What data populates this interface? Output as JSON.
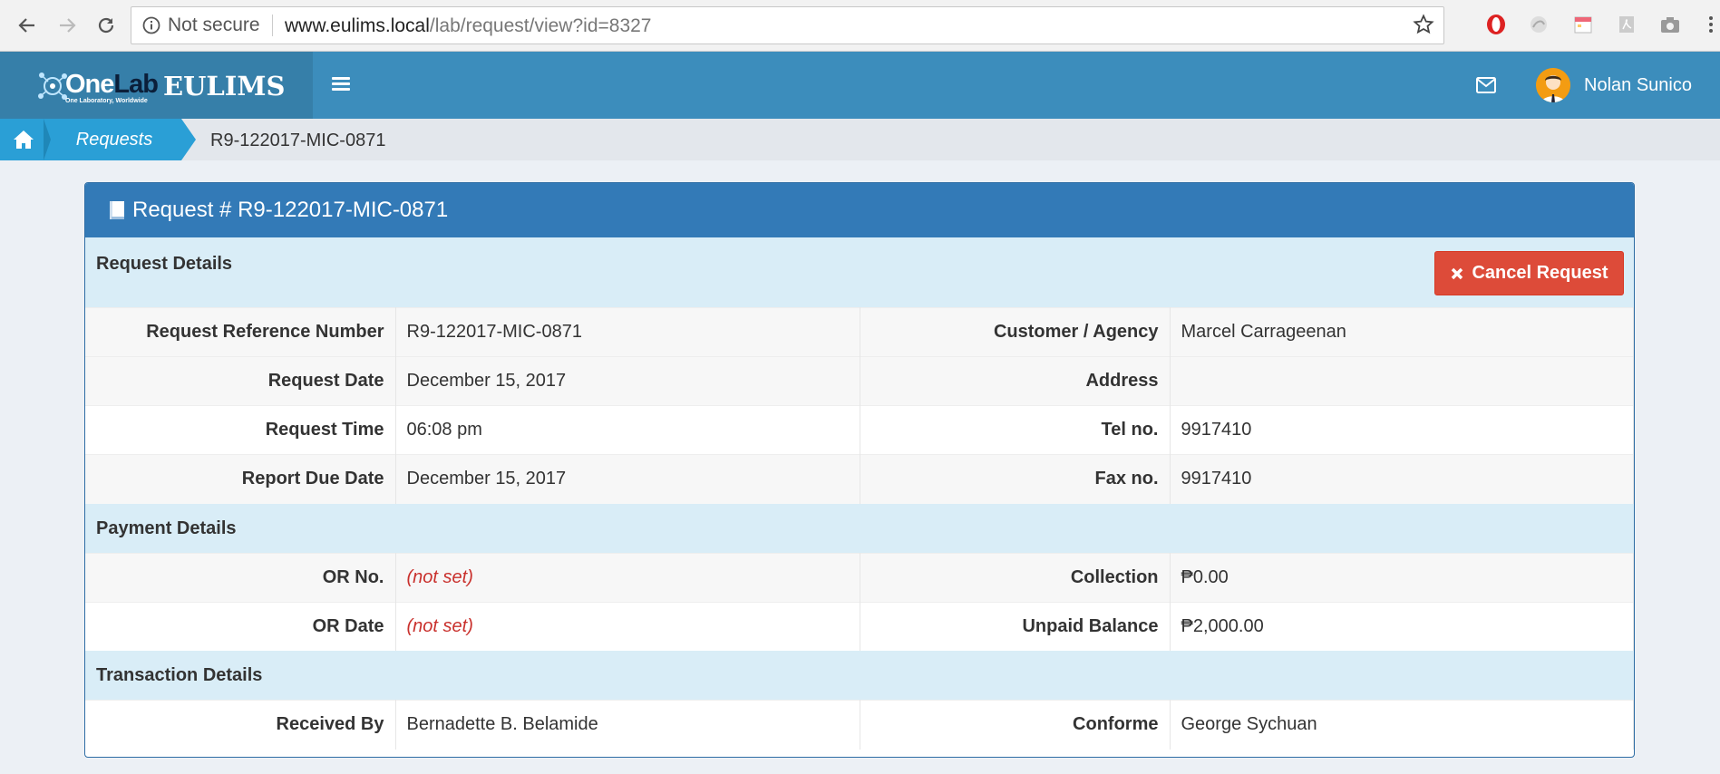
{
  "browser": {
    "security_label": "Not secure",
    "url_host": "www.eulims.local",
    "url_path": "/lab/request/view?id=8327"
  },
  "header": {
    "logo_one": "One",
    "logo_lab": "Lab",
    "logo_tagline": "One Laboratory, Worldwide",
    "logo_eulims": "EULIMS",
    "user_name": "Nolan Sunico"
  },
  "breadcrumb": {
    "requests": "Requests",
    "current": "R9-122017-MIC-0871"
  },
  "panel": {
    "title": "Request # R9-122017-MIC-0871",
    "cancel_label": "Cancel Request",
    "sections": {
      "request": "Request Details",
      "payment": "Payment Details",
      "transaction": "Transaction Details"
    },
    "request_rows": [
      {
        "k1": "Request Reference Number",
        "v1": "R9-122017-MIC-0871",
        "k2": "Customer / Agency",
        "v2": "Marcel Carrageenan"
      },
      {
        "k1": "Request Date",
        "v1": "December 15, 2017",
        "k2": "Address",
        "v2": ""
      },
      {
        "k1": "Request Time",
        "v1": "06:08 pm",
        "k2": "Tel no.",
        "v2": "9917410"
      },
      {
        "k1": "Report Due Date",
        "v1": "December 15, 2017",
        "k2": "Fax no.",
        "v2": "9917410"
      }
    ],
    "payment_rows": [
      {
        "k1": "OR No.",
        "v1": "(not set)",
        "k2": "Collection",
        "v2": "₱0.00"
      },
      {
        "k1": "OR Date",
        "v1": "(not set)",
        "k2": "Unpaid Balance",
        "v2": "₱2,000.00"
      }
    ],
    "transaction_rows": [
      {
        "k1": "Received By",
        "v1": "Bernadette B. Belamide",
        "k2": "Conforme",
        "v2": "George Sychuan"
      }
    ]
  },
  "colors": {
    "header_blue": "#3c8dbc",
    "panel_blue": "#337ab7",
    "danger": "#dd4b39",
    "section_bg": "#d9edf7"
  }
}
